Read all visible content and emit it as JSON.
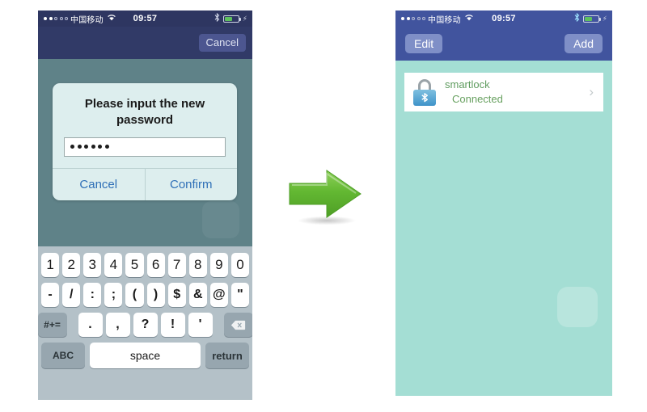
{
  "left_phone": {
    "status_bar": {
      "signal_dots_filled": 2,
      "signal_dots_total": 5,
      "carrier": "中国移动",
      "wifi_icon": "wifi-icon",
      "time": "09:57",
      "bluetooth_icon": "bluetooth-icon",
      "battery_icon": "battery-icon",
      "charging_icon": "charging-bolt-icon"
    },
    "navbar": {
      "cancel_label": "Cancel"
    },
    "dialog": {
      "title": "Please input the new password",
      "password_value": "••••••",
      "password_dot_count": 6,
      "cancel_label": "Cancel",
      "confirm_label": "Confirm"
    },
    "keyboard": {
      "row1": [
        "1",
        "2",
        "3",
        "4",
        "5",
        "6",
        "7",
        "8",
        "9",
        "0"
      ],
      "row2": [
        "-",
        "/",
        ":",
        ";",
        "(",
        ")",
        "$",
        "&",
        "@",
        "\""
      ],
      "row3_left_label": "#+=",
      "row3": [
        ".",
        ",",
        "?",
        "!",
        "'"
      ],
      "row3_backspace": "backspace-icon",
      "row4": {
        "abc_label": "ABC",
        "space_label": "space",
        "return_label": "return"
      }
    }
  },
  "arrow": {
    "name": "green-right-arrow",
    "color": "#6cbe3f"
  },
  "right_phone": {
    "status_bar": {
      "signal_dots_filled": 2,
      "signal_dots_total": 5,
      "carrier": "中国移动",
      "wifi_icon": "wifi-icon",
      "time": "09:57",
      "bluetooth_icon": "bluetooth-icon",
      "battery_icon": "battery-icon",
      "charging_icon": "charging-bolt-icon"
    },
    "navbar": {
      "edit_label": "Edit",
      "add_label": "Add"
    },
    "list": [
      {
        "icon": "bluetooth-padlock-icon",
        "title": "smartlock",
        "subtitle": "Connected",
        "chevron": "›"
      }
    ]
  },
  "colors": {
    "left_navbar": "#313a67",
    "left_statusbar": "#2e3661",
    "left_body": "#5f8288",
    "dialog_bg": "#ddeeee",
    "dialog_link": "#2e6fb7",
    "keyboard_bg": "#b4c1c8",
    "right_navbar": "#41549e",
    "right_body": "#a4ded4",
    "list_title": "#5f9c5f",
    "arrow_green": "#6cbe3f"
  }
}
